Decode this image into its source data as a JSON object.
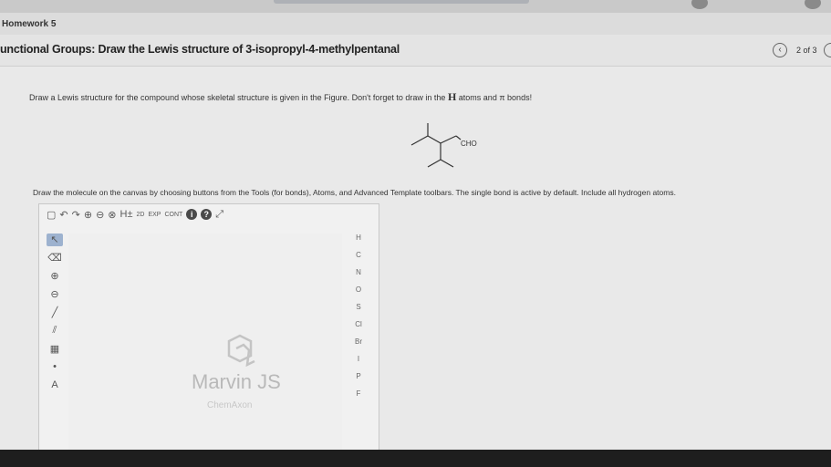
{
  "homework": {
    "title": "Homework 5"
  },
  "question": {
    "title": "unctional Groups: Draw the Lewis structure of 3-isopropyl-4-methylpentanal",
    "page_count": "2 of 3",
    "instruction_pre": "Draw a Lewis structure for the compound whose skeletal structure is given in the Figure. Don't forget to draw in the ",
    "instruction_h": "H",
    "instruction_mid": " atoms and ",
    "instruction_pi": "π",
    "instruction_post": " bonds!",
    "molecule_label": "CHO",
    "editor_instruction": "Draw the molecule on the canvas by choosing buttons from the Tools (for bonds), Atoms, and Advanced Template toolbars. The single bond is active by default. Include all hydrogen atoms."
  },
  "editor": {
    "toolbar": {
      "new": "▢",
      "undo": "↶",
      "redo": "↷",
      "zoom_in": "⊕",
      "zoom_out": "⊖",
      "zoom_fit": "⊗",
      "h_toggle": "H±",
      "tb_2d": "2D",
      "exp": "EXP",
      "cont": "CONT",
      "info": "i",
      "help": "?",
      "fullscreen": "⤢"
    },
    "left_tools": [
      "↖",
      "⌫",
      "⊕",
      "⊖",
      "╱",
      "⫽",
      "▦",
      "•",
      "A"
    ],
    "atoms": [
      "H",
      "C",
      "N",
      "O",
      "S",
      "Cl",
      "Br",
      "I",
      "P",
      "F"
    ],
    "watermark": "Marvin JS",
    "watermark_sub": "ChemAxon"
  }
}
